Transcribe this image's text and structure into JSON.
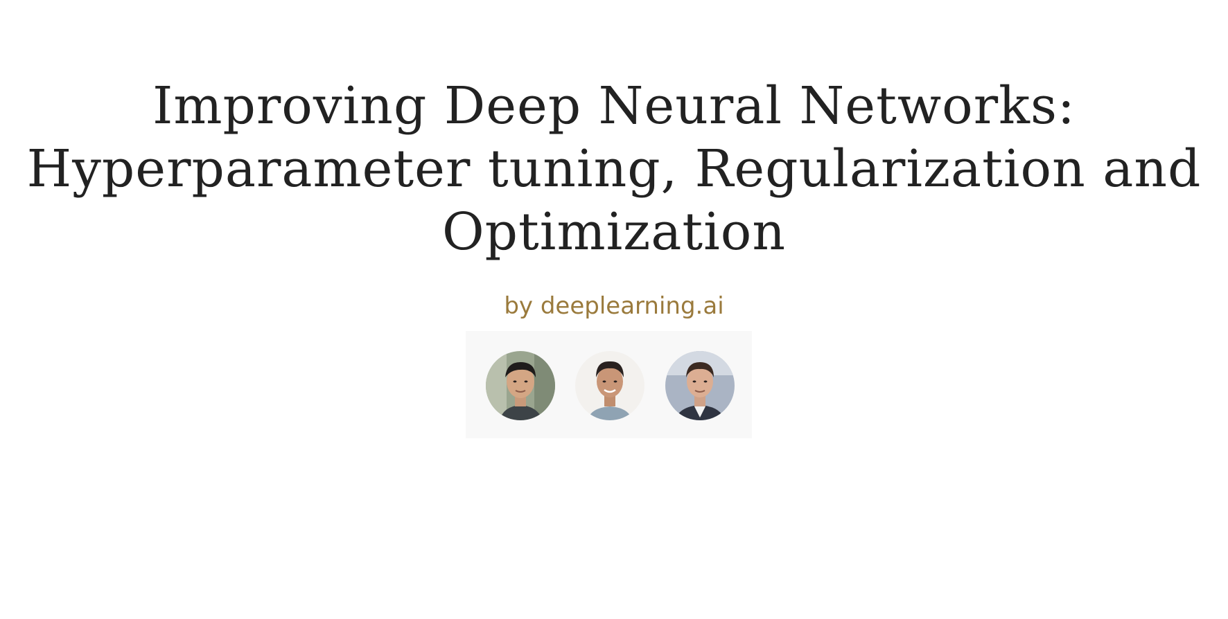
{
  "course": {
    "title_lines": [
      "Improving Deep Neural Networks:",
      "Hyperparameter tuning, Regularization and",
      "Optimization"
    ],
    "partner_text": "by deeplearning.ai"
  },
  "instructors": [
    {
      "avatar_icon": "instructor-photo-1"
    },
    {
      "avatar_icon": "instructor-photo-2"
    },
    {
      "avatar_icon": "instructor-photo-3"
    }
  ],
  "colors": {
    "title": "#222222",
    "partner": "#9a7a3c",
    "strip_background": "#f8f8f8",
    "page_background": "#ffffff"
  }
}
